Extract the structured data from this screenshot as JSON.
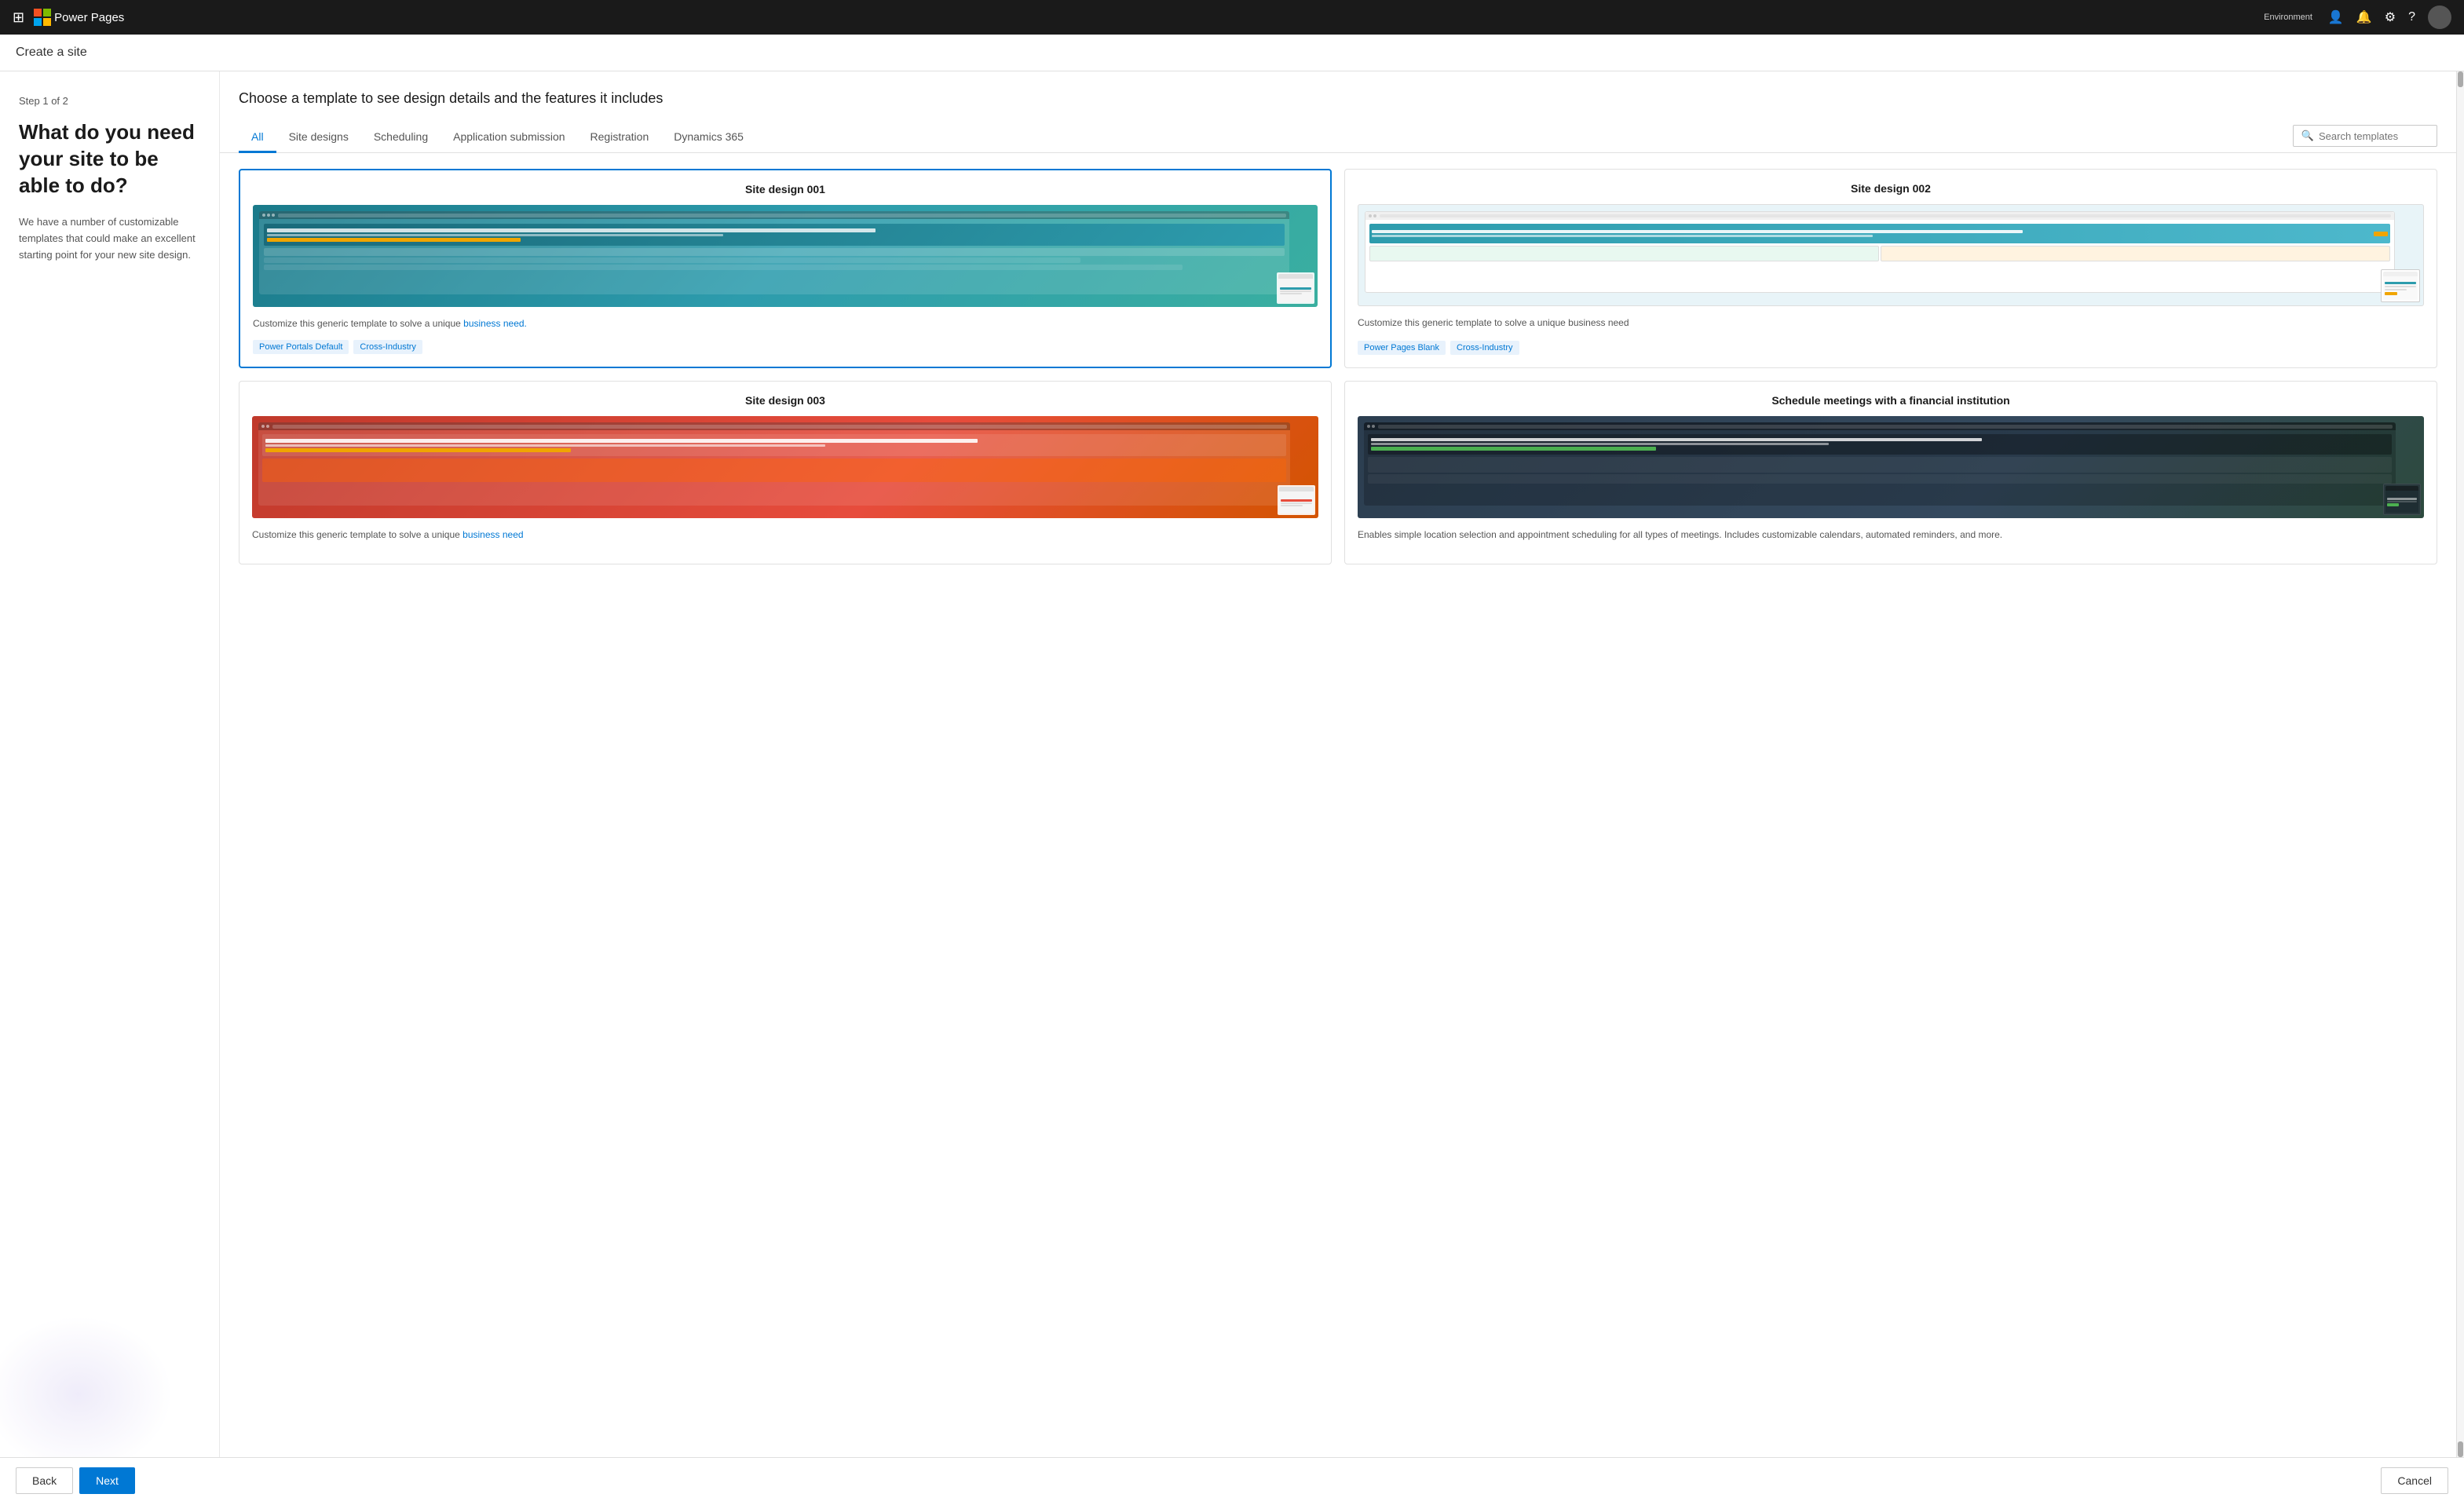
{
  "topnav": {
    "app_name": "Power Pages",
    "env_label": "Environment",
    "env_name": ""
  },
  "page": {
    "title": "Create a site"
  },
  "sidebar": {
    "step_label": "Step 1 of 2",
    "heading": "What do you need your site to be able to do?",
    "description": "We have a number of customizable templates that could make an excellent starting point for your new site design."
  },
  "content": {
    "title": "Choose a template to see design details and the features it includes",
    "tabs": [
      {
        "label": "All",
        "active": true
      },
      {
        "label": "Site designs",
        "active": false
      },
      {
        "label": "Scheduling",
        "active": false
      },
      {
        "label": "Application submission",
        "active": false
      },
      {
        "label": "Registration",
        "active": false
      },
      {
        "label": "Dynamics 365",
        "active": false
      }
    ],
    "search_placeholder": "Search templates",
    "templates": [
      {
        "id": "site-001",
        "title": "Site design 001",
        "description": "Customize this generic template to solve a unique",
        "description_link": "business need.",
        "tags": [
          "Power Portals Default",
          "Cross-Industry"
        ],
        "selected": true,
        "preview_class": "preview-001"
      },
      {
        "id": "site-002",
        "title": "Site design 002",
        "description": "Customize this generic template to solve a unique business need",
        "description_link": "",
        "tags": [
          "Power Pages Blank",
          "Cross-Industry"
        ],
        "selected": false,
        "preview_class": "preview-002"
      },
      {
        "id": "site-003",
        "title": "Site design 003",
        "description": "Customize this generic template to solve a unique",
        "description_link": "business need",
        "tags": [],
        "selected": false,
        "preview_class": "preview-003"
      },
      {
        "id": "site-004",
        "title": "Schedule meetings with a financial institution",
        "description": "Enables simple location selection and appointment scheduling for all types of meetings. Includes customizable calendars, automated reminders, and more.",
        "description_link": "",
        "tags": [],
        "selected": false,
        "preview_class": "preview-004"
      }
    ]
  },
  "footer": {
    "back_label": "Back",
    "next_label": "Next",
    "cancel_label": "Cancel"
  }
}
